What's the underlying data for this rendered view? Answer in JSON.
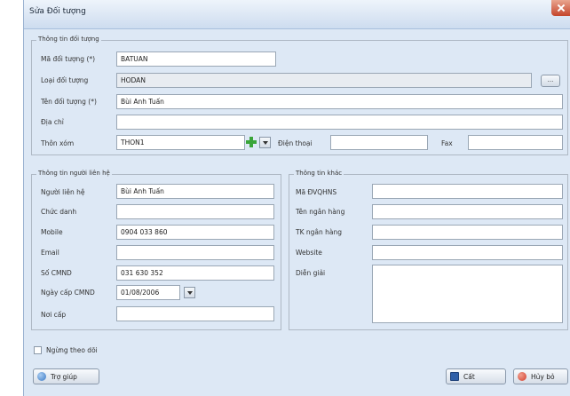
{
  "window": {
    "title": "Sửa Đối tượng"
  },
  "object_info": {
    "group_label": "Thông tin đối tượng",
    "code_label": "Mã đối tượng (*)",
    "code_value": "BATUAN",
    "type_label": "Loại đối tượng",
    "type_value": "HODAN",
    "type_button": "...",
    "name_label": "Tên đối tượng (*)",
    "name_value": "Bùi Anh Tuấn",
    "address_label": "Địa chỉ",
    "address_value": "",
    "hamlet_label": "Thôn xóm",
    "hamlet_value": "THON1",
    "phone_label": "Điện thoại",
    "phone_value": "",
    "fax_label": "Fax",
    "fax_value": ""
  },
  "contact_info": {
    "group_label": "Thông tin người liên hệ",
    "person_label": "Người liên hệ",
    "person_value": "Bùi Anh Tuấn",
    "title_label": "Chức danh",
    "title_value": "",
    "mobile_label": "Mobile",
    "mobile_value": "0904 033 860",
    "email_label": "Email",
    "email_value": "",
    "id_label": "Số CMND",
    "id_value": "031 630 352",
    "issue_date_label": "Ngày cấp CMND",
    "issue_date_value": "01/08/2006",
    "issue_place_label": "Nơi cấp",
    "issue_place_value": ""
  },
  "other_info": {
    "group_label": "Thông tin khác",
    "unit_code_label": "Mã ĐVQHNS",
    "unit_code_value": "",
    "bank_name_label": "Tên ngân hàng",
    "bank_name_value": "",
    "bank_account_label": "TK ngân hàng",
    "bank_account_value": "",
    "website_label": "Website",
    "website_value": "",
    "note_label": "Diễn giải",
    "note_value": ""
  },
  "stop_tracking_label": "Ngừng theo dõi",
  "buttons": {
    "help": "Trợ giúp",
    "save": "Cất",
    "cancel": "Hủy bỏ"
  },
  "colors": {
    "window_bg": "#dde8f5",
    "help_icon": "#3b78c4",
    "save_icon": "#2f5fa8",
    "cancel_icon": "#d23c2c",
    "add_icon": "#3aa53a"
  },
  "icons": {
    "help": "help-icon",
    "save": "save-icon",
    "cancel": "cancel-icon",
    "add": "add-icon",
    "close": "close-icon"
  }
}
